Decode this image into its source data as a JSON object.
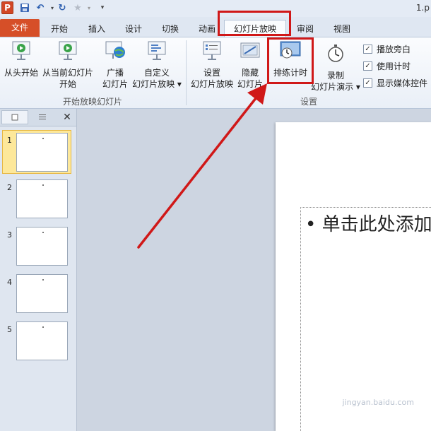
{
  "window": {
    "title": "1.p"
  },
  "tabs": [
    {
      "label": "文件"
    },
    {
      "label": "开始"
    },
    {
      "label": "插入"
    },
    {
      "label": "设计"
    },
    {
      "label": "切换"
    },
    {
      "label": "动画"
    },
    {
      "label": "幻灯片放映"
    },
    {
      "label": "审阅"
    },
    {
      "label": "视图"
    }
  ],
  "ribbon": {
    "groups": {
      "start": {
        "label": "开始放映幻灯片"
      },
      "setup": {
        "label": "设置"
      }
    },
    "buttons": {
      "from_beginning": "从头开始",
      "from_current_1": "从当前幻灯片",
      "from_current_2": "开始",
      "broadcast_1": "广播",
      "broadcast_2": "幻灯片",
      "custom_1": "自定义",
      "custom_2": "幻灯片放映 ▾",
      "setup_1": "设置",
      "setup_2": "幻灯片放映",
      "hide_1": "隐藏",
      "hide_2": "幻灯片",
      "rehearse": "排练计时",
      "record_1": "录制",
      "record_2": "幻灯片演示 ▾"
    },
    "checkboxes": [
      {
        "label": "播放旁白",
        "checked": true
      },
      {
        "label": "使用计时",
        "checked": true
      },
      {
        "label": "显示媒体控件",
        "checked": true
      }
    ]
  },
  "slides_pane": {
    "thumbnails": [
      {
        "number": "1",
        "selected": true
      },
      {
        "number": "2",
        "selected": false
      },
      {
        "number": "3",
        "selected": false
      },
      {
        "number": "4",
        "selected": false
      },
      {
        "number": "5",
        "selected": false
      }
    ]
  },
  "slide": {
    "placeholder": "单击此处添加"
  },
  "watermark": "jingyan.baidu.com",
  "colors": {
    "accent": "#d64f28",
    "annotation": "#d01818"
  }
}
